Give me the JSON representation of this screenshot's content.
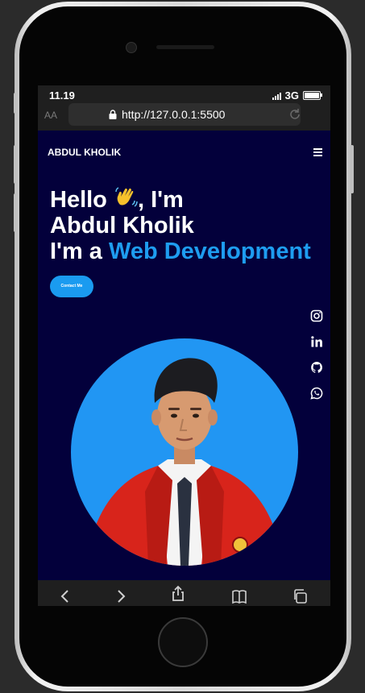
{
  "status_bar": {
    "time": "11.19",
    "network": "3G"
  },
  "browser": {
    "text_size": "AA",
    "url": "http://127.0.0.1:5500"
  },
  "navbar": {
    "brand": "ABDUL KHOLIK"
  },
  "hero": {
    "line1_text": "Hello ",
    "line1_end": ", I'm",
    "line2": "Abdul Kholik",
    "line3_prefix": "I'm a ",
    "line3_highlight": "Web Development",
    "cta_label": "Contact Me"
  },
  "social": [
    "instagram-icon",
    "linkedin-icon",
    "github-icon",
    "whatsapp-icon"
  ],
  "colors": {
    "background": "#03003b",
    "accent": "#1e9df0",
    "avatar_bg": "#2196f3",
    "jacket": "#d8241b"
  }
}
